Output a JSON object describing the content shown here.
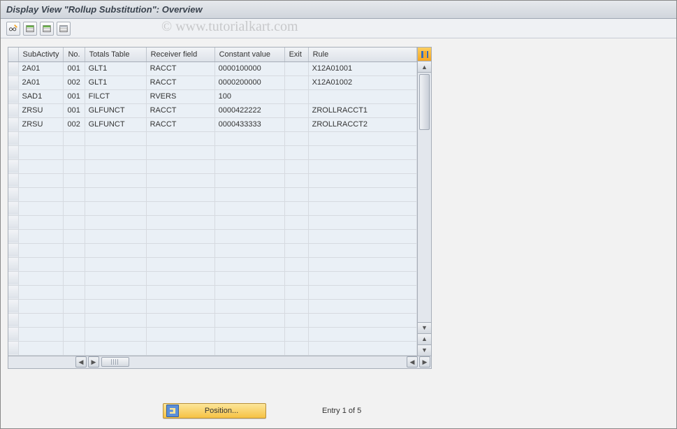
{
  "title": "Display View \"Rollup Substitution\": Overview",
  "watermark": "© www.tutorialkart.com",
  "toolbar": {
    "edit": "Change",
    "row_icon1": "Select All",
    "row_icon2": "Deselect All",
    "row_icon3": "Table Settings"
  },
  "grid": {
    "columns": [
      "SubActivty",
      "No.",
      "Totals Table",
      "Receiver field",
      "Constant value",
      "Exit",
      "Rule"
    ],
    "rows": [
      {
        "sub": "2A01",
        "no": "001",
        "tt": "GLT1",
        "rf": "RACCT",
        "cv": "0000100000",
        "ex": "",
        "rule": "X12A01001"
      },
      {
        "sub": "2A01",
        "no": "002",
        "tt": "GLT1",
        "rf": "RACCT",
        "cv": "0000200000",
        "ex": "",
        "rule": "X12A01002"
      },
      {
        "sub": "SAD1",
        "no": "001",
        "tt": "FILCT",
        "rf": "RVERS",
        "cv": "100",
        "ex": "",
        "rule": ""
      },
      {
        "sub": "ZRSU",
        "no": "001",
        "tt": "GLFUNCT",
        "rf": "RACCT",
        "cv": "0000422222",
        "ex": "",
        "rule": "ZROLLRACCT1"
      },
      {
        "sub": "ZRSU",
        "no": "002",
        "tt": "GLFUNCT",
        "rf": "RACCT",
        "cv": "0000433333",
        "ex": "",
        "rule": "ZROLLRACCT2"
      }
    ],
    "empty_rows": 16
  },
  "footer": {
    "position_label": "Position...",
    "entry_text": "Entry 1 of 5"
  }
}
